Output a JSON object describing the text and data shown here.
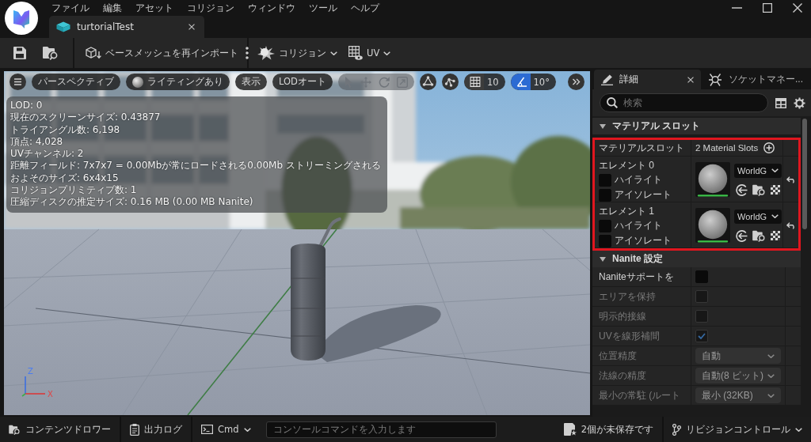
{
  "menu": [
    "ファイル",
    "編集",
    "アセット",
    "コリジョン",
    "ウィンドウ",
    "ツール",
    "ヘルプ"
  ],
  "document_tabs": [
    {
      "label": "turtorialTest",
      "selected": true
    }
  ],
  "toolbar": {
    "reimport": "ベースメッシュを再インポート",
    "collision": "コリジョン",
    "uv": "UV"
  },
  "viewport": {
    "toolbar": {
      "view_mode": "パースペクティブ",
      "lighting": "ライティングあり",
      "show": "表示",
      "lod": "LODオート",
      "transform_tools_disabled": true,
      "snaps": [
        {
          "kind": "grid",
          "value": "10",
          "on": false
        },
        {
          "kind": "angle",
          "value": "10°",
          "on": true
        }
      ]
    },
    "stats": [
      "LOD: 0",
      "現在のスクリーンサイズ: 0.43877",
      "トライアングル数: 6,198",
      "頂点: 4,028",
      "UVチャンネル: 2",
      "距離フィールド: 7x7x7 = 0.00Mbが常にロードされる0.00Mb ストリーミングされる",
      "およそのサイズ: 6x4x15",
      "コリジョンプリミティブ数: 1",
      "圧縮ディスクの推定サイズ: 0.16 MB (0.00 MB Nanite)"
    ],
    "axes": {
      "up": "Z",
      "right": "X"
    }
  },
  "details_panel": {
    "tabs": [
      {
        "kind": "details",
        "label": "詳細",
        "selected": true
      },
      {
        "kind": "sockets",
        "label": "ソケットマネー...",
        "selected": false
      }
    ],
    "search": {
      "placeholder": "検索"
    },
    "sections": [
      {
        "kind": "material_slots",
        "title": "マテリアル スロット",
        "expanded": true,
        "highlighted": true,
        "slot_label": "マテリアルスロット",
        "slot_count": "2 Material Slots",
        "elements": [
          {
            "label": "エレメント 0",
            "material": "WorldG",
            "options": [
              {
                "label": "ハイライト",
                "checked": false
              },
              {
                "label": "アイソレート",
                "checked": false
              }
            ]
          },
          {
            "label": "エレメント 1",
            "material": "WorldG",
            "options": [
              {
                "label": "ハイライト",
                "checked": false
              },
              {
                "label": "アイソレート",
                "checked": false
              }
            ]
          }
        ]
      },
      {
        "kind": "properties",
        "title": "Nanite 設定",
        "expanded": true,
        "rows": [
          {
            "kind": "checkbox",
            "label": "Naniteサポートを",
            "checked": false,
            "disabled": false
          },
          {
            "kind": "checkbox",
            "label": "エリアを保持",
            "checked": false,
            "disabled": true
          },
          {
            "kind": "checkbox",
            "label": "明示的接線",
            "checked": false,
            "disabled": true
          },
          {
            "kind": "checkbox",
            "label": "UVを線形補間",
            "checked": true,
            "disabled": true
          },
          {
            "kind": "dropdown",
            "label": "位置精度",
            "value": "自動",
            "disabled": true
          },
          {
            "kind": "dropdown",
            "label": "法線の精度",
            "value": "自動(8 ビット)",
            "disabled": true
          },
          {
            "kind": "dropdown",
            "label": "最小の常駐 (ルート",
            "value": "最小 (32KB)",
            "disabled": true
          }
        ]
      }
    ]
  },
  "status_bar": {
    "content_drawer": "コンテンツドロワー",
    "output_log": "出力ログ",
    "cmd": "Cmd",
    "console_placeholder": "コンソールコマンドを入力します",
    "unsaved": "2個が未保存です",
    "revision_control": "リビジョンコントロール"
  }
}
